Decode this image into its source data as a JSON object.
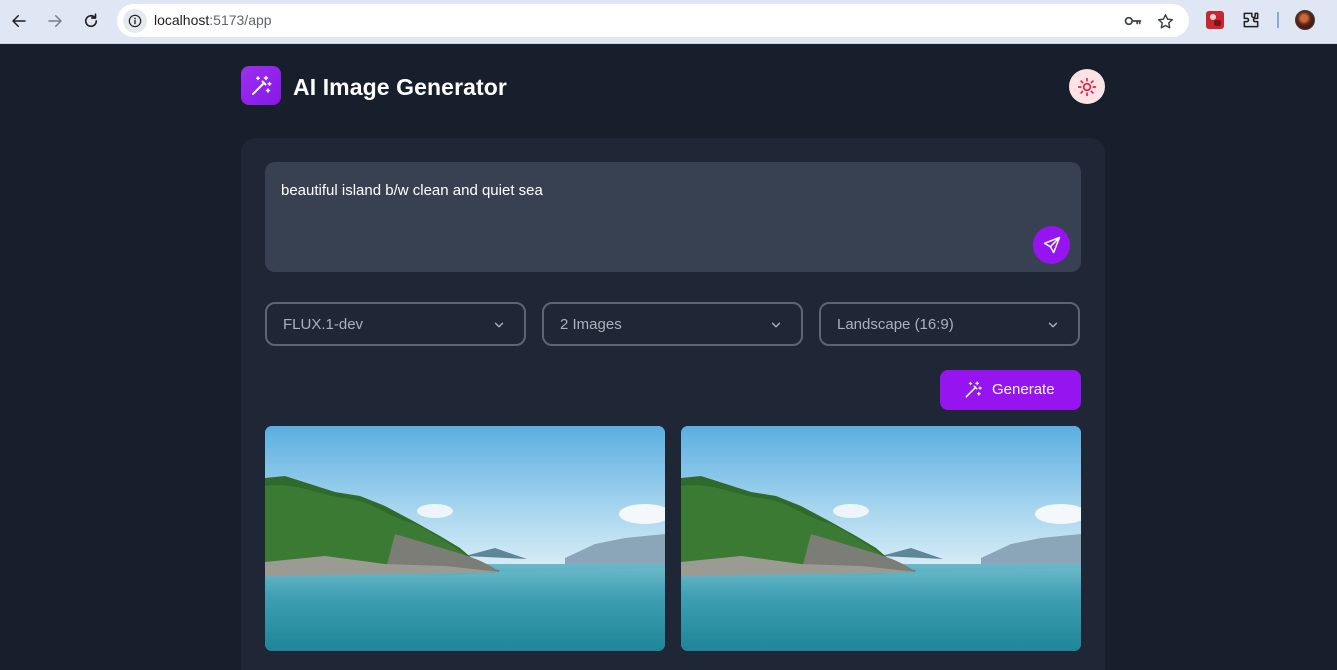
{
  "browser": {
    "url_host": "localhost",
    "url_path": ":5173/app",
    "icons": [
      "back-icon",
      "forward-icon",
      "reload-icon",
      "site-info-icon",
      "password-key-icon",
      "bookmark-star-icon",
      "extension-icon",
      "extensions-puzzle-icon",
      "profile-avatar"
    ]
  },
  "app": {
    "title": "AI Image Generator",
    "logo_icon": "magic-wand-icon",
    "theme_icon": "sun-icon"
  },
  "prompt": {
    "value": "beautiful island b/w clean and quiet sea",
    "send_icon": "send-icon"
  },
  "options": {
    "model": "FLUX.1-dev",
    "count": "2 Images",
    "aspect_ratio": "Landscape (16:9)"
  },
  "generate": {
    "label": "Generate",
    "icon": "magic-wand-icon"
  },
  "results": {
    "images": [
      {
        "alt": "Generated image 1"
      },
      {
        "alt": "Generated image 2"
      }
    ]
  },
  "colors": {
    "page_bg": "#171e2c",
    "panel_bg": "#1f2737",
    "input_bg": "#384152",
    "accent": "#9514f0",
    "theme_toggle_bg": "#fde3e4",
    "sun": "#e11d48"
  }
}
